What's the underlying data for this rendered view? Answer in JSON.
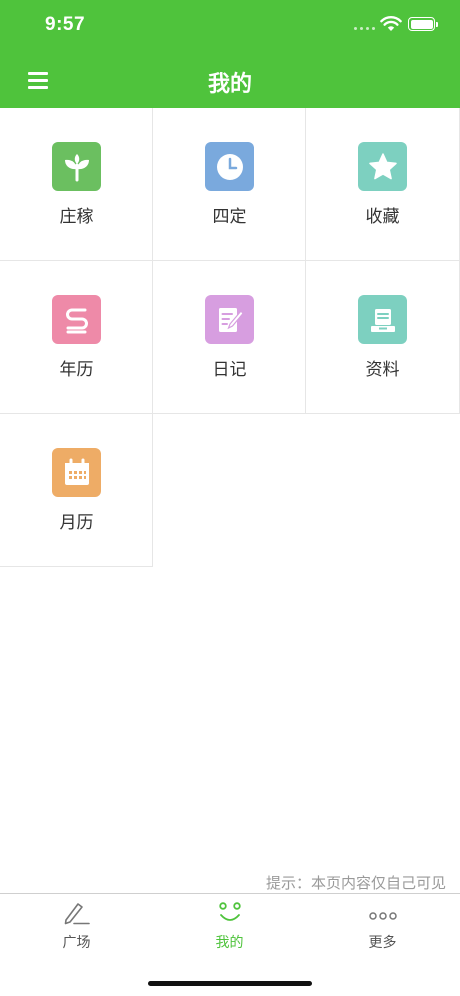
{
  "status_bar": {
    "time": "9:57"
  },
  "header": {
    "title": "我的"
  },
  "grid": {
    "items": [
      {
        "label": "庄稼",
        "icon": "sprout-icon",
        "color": "#6bbf60"
      },
      {
        "label": "四定",
        "icon": "clock-icon",
        "color": "#7aa9dd"
      },
      {
        "label": "收藏",
        "icon": "star-icon",
        "color": "#7dd0c0"
      },
      {
        "label": "年历",
        "icon": "almanac-icon",
        "color": "#ee8aa8"
      },
      {
        "label": "日记",
        "icon": "diary-icon",
        "color": "#d79ee0"
      },
      {
        "label": "资料",
        "icon": "document-icon",
        "color": "#7dd0c0"
      },
      {
        "label": "月历",
        "icon": "calendar-icon",
        "color": "#eeac66"
      }
    ]
  },
  "hint": "提示：本页内容仅自己可见",
  "tabbar": {
    "active_color": "#4fc33c",
    "tabs": [
      {
        "label": "广场",
        "icon": "pen-icon"
      },
      {
        "label": "我的",
        "icon": "smile-icon",
        "active": true
      },
      {
        "label": "更多",
        "icon": "more-icon"
      }
    ]
  }
}
